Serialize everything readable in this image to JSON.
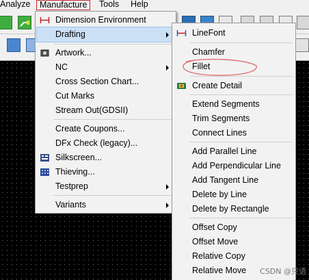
{
  "menubar": {
    "items": [
      "Analyze",
      "Manufacture",
      "Tools",
      "Help"
    ]
  },
  "manufacture_menu": {
    "items": [
      "Dimension Environment",
      "Drafting",
      "Artwork...",
      "NC",
      "Cross Section Chart...",
      "Cut Marks",
      "Stream Out(GDSII)",
      "Create Coupons...",
      "DFx Check (legacy)...",
      "Silkscreen...",
      "Thieving...",
      "Testprep",
      "Variants"
    ]
  },
  "drafting_menu": {
    "items": [
      "LineFont",
      "Chamfer",
      "Fillet",
      "Create Detail",
      "Extend Segments",
      "Trim Segments",
      "Connect Lines",
      "Add Parallel Line",
      "Add Perpendicular Line",
      "Add Tangent Line",
      "Delete by Line",
      "Delete by Rectangle",
      "Offset Copy",
      "Offset Move",
      "Relative Copy",
      "Relative Move"
    ]
  },
  "watermark": "CSDN @只语",
  "colors": {
    "highlight": "#cce0f5",
    "annotation": "#e07070",
    "active_menu_border": "#c8282e"
  }
}
